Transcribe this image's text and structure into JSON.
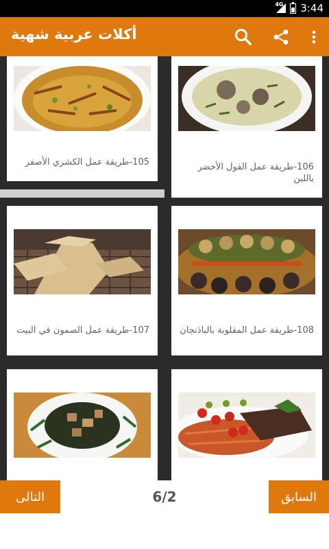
{
  "status": {
    "time": "3:44",
    "network": "4G"
  },
  "app": {
    "title": "أكلات عربية شهية",
    "accent": "#e0790d"
  },
  "toolbar": {
    "icons": [
      "search-icon",
      "share-icon",
      "overflow-menu-icon"
    ]
  },
  "items": [
    {
      "title": "105-طريقة عمل الكشري الأصفر"
    },
    {
      "title": "106-طريقة عمل الفول الأخضر باللبن"
    },
    {
      "title": "107-طريقة عمل الصمون في البيت"
    },
    {
      "title": "108-طريقة عمل المقلوبة بالباذنجان"
    },
    {
      "title": ""
    },
    {
      "title": ""
    }
  ],
  "pagination": {
    "next_label": "التالى",
    "prev_label": "السابق",
    "page_text": "6/2"
  }
}
